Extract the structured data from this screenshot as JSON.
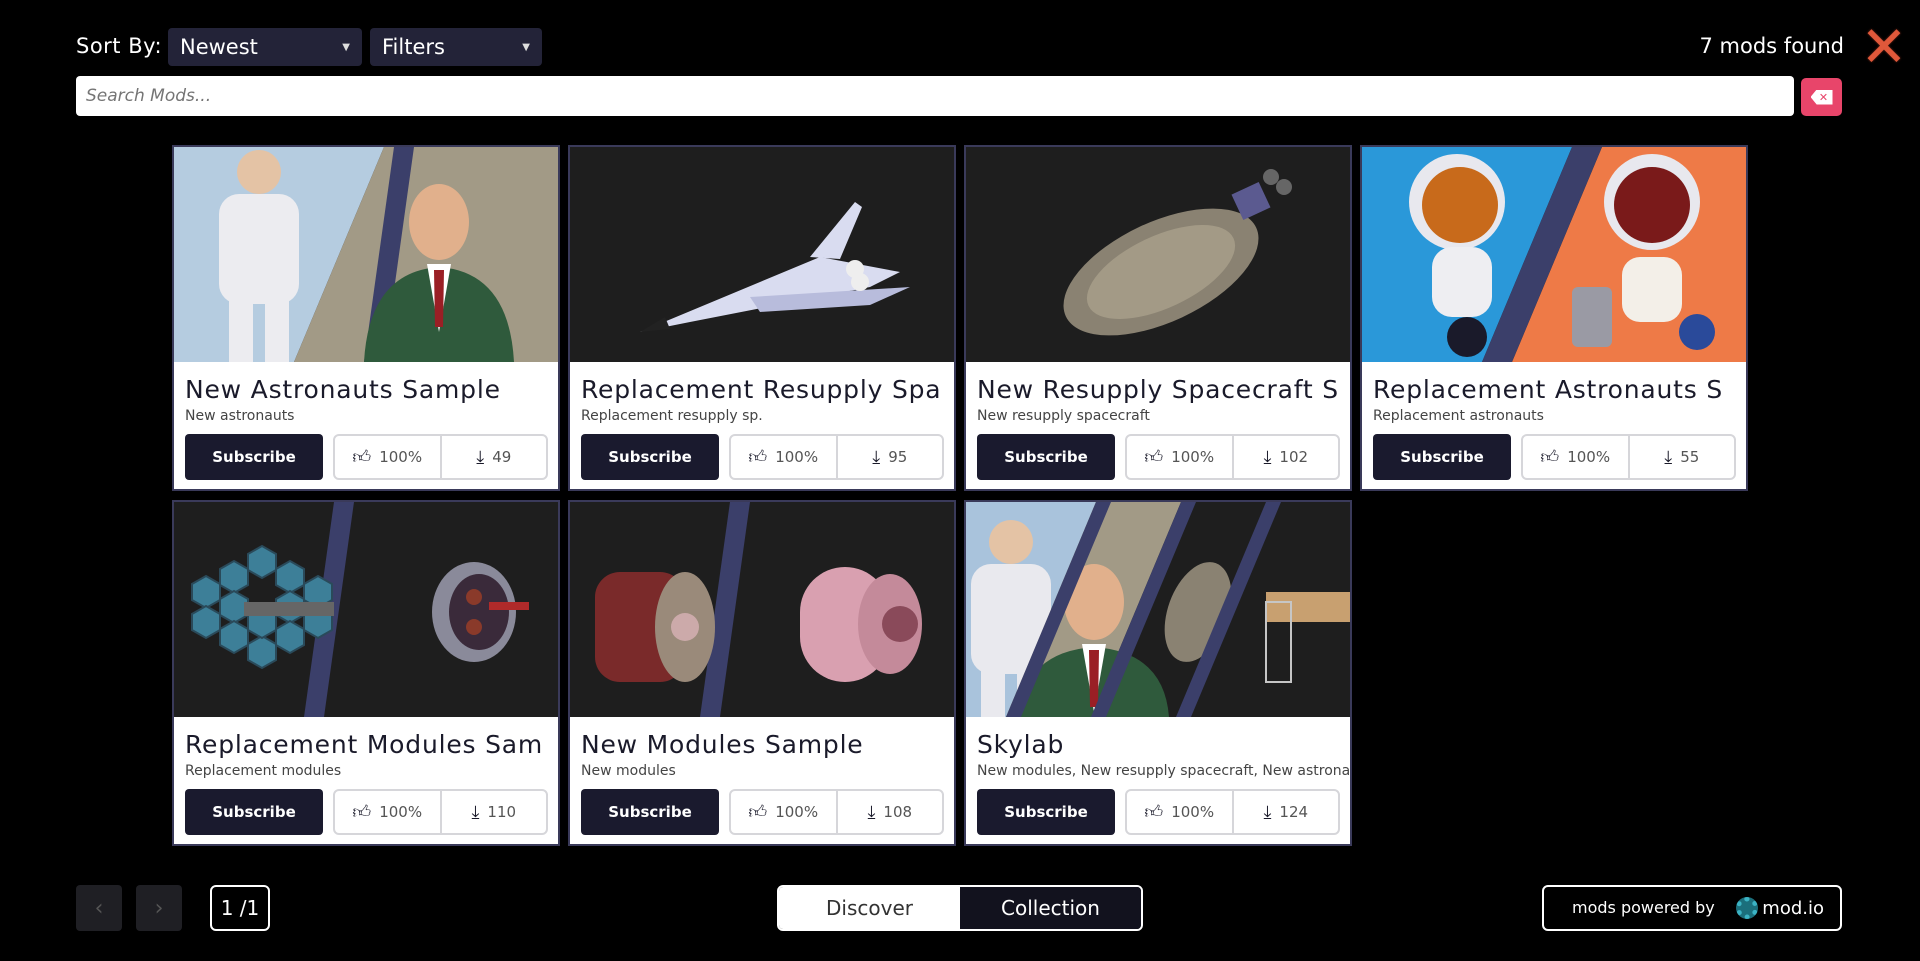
{
  "header": {
    "sort_label": "Sort By:",
    "sort_value": "Newest",
    "filters_label": "Filters",
    "mods_found": "7 mods found"
  },
  "search": {
    "placeholder": "Search Mods..."
  },
  "mods": [
    {
      "title": "New Astronauts Sample",
      "subtitle": "New astronauts",
      "subscribe": "Subscribe",
      "rating": "100%",
      "downloads": "49",
      "thumb": "astronauts"
    },
    {
      "title": "Replacement Resupply Spa",
      "subtitle": "Replacement resupply sp.",
      "subscribe": "Subscribe",
      "rating": "100%",
      "downloads": "95",
      "thumb": "shuttle"
    },
    {
      "title": "New Resupply Spacecraft S",
      "subtitle": "New resupply spacecraft",
      "subscribe": "Subscribe",
      "rating": "100%",
      "downloads": "102",
      "thumb": "capsule"
    },
    {
      "title": "Replacement Astronauts S",
      "subtitle": "Replacement astronauts",
      "subscribe": "Subscribe",
      "rating": "100%",
      "downloads": "55",
      "thumb": "cartoon-astronauts"
    },
    {
      "title": "Replacement Modules Sam",
      "subtitle": "Replacement modules",
      "subscribe": "Subscribe",
      "rating": "100%",
      "downloads": "110",
      "thumb": "telescope-module"
    },
    {
      "title": "New Modules Sample",
      "subtitle": "New modules",
      "subscribe": "Subscribe",
      "rating": "100%",
      "downloads": "108",
      "thumb": "modules"
    },
    {
      "title": "Skylab",
      "subtitle": "New modules, New resupply spacecraft, New astrona",
      "subscribe": "Subscribe",
      "rating": "100%",
      "downloads": "124",
      "thumb": "skylab"
    }
  ],
  "footer": {
    "page": "1 /1",
    "tab_discover": "Discover",
    "tab_collection": "Collection",
    "powered_by": "mods powered by",
    "brand": "mod.io"
  }
}
